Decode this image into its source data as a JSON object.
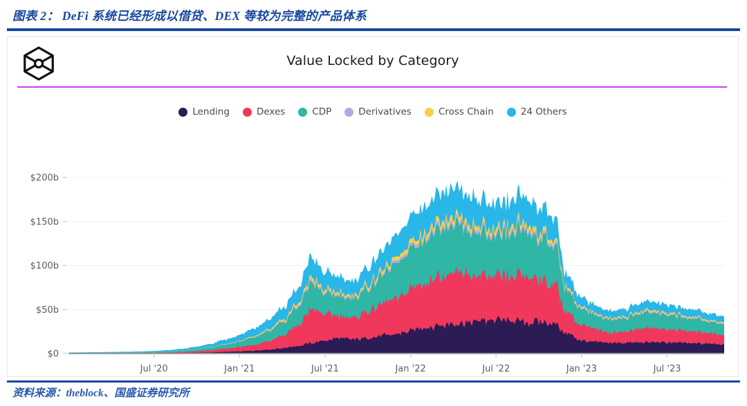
{
  "report": {
    "title": "图表 2： DeFi 系统已经形成以借贷、DEX 等较为完整的产品体系",
    "source": "资料来源：theblock、国盛证券研究所",
    "rule_color": "#14479e",
    "title_color": "#18479e"
  },
  "card": {
    "logo_name": "theblock-hexagon-logo",
    "divider_color": "#cc3df0",
    "border_color": "#e6e6e6"
  },
  "chart_data": {
    "type": "area",
    "stacked": true,
    "title": "Value Locked by Category",
    "xlabel": "",
    "ylabel": "",
    "ylim": [
      0,
      200
    ],
    "y_unit": "b",
    "y_ticks": [
      0,
      50,
      100,
      150,
      200
    ],
    "y_tick_labels": [
      "$0",
      "$50b",
      "$100b",
      "$150b",
      "$200b"
    ],
    "x_ticks": [
      6,
      12,
      18,
      24,
      30,
      36,
      42
    ],
    "x_tick_labels": [
      "Jul '20",
      "Jan '21",
      "Jul '21",
      "Jan '22",
      "Jul '22",
      "Jan '23",
      "Jul '23"
    ],
    "x_range": [
      0,
      46
    ],
    "grid": true,
    "legend_position": "top-center",
    "series": [
      {
        "name": "Lending",
        "color": "#2c1b54",
        "values": [
          0.15,
          0.2,
          0.25,
          0.3,
          0.35,
          0.4,
          0.5,
          0.6,
          0.8,
          1.0,
          1.3,
          1.8,
          2.4,
          3.2,
          4.5,
          6.0,
          8.5,
          11.5,
          15.0,
          17.5,
          16.0,
          18.0,
          20.0,
          22.0,
          26.0,
          29.0,
          32.0,
          34.0,
          35.5,
          37.0,
          38.5,
          37.0,
          35.0,
          36.5,
          34.0,
          22.0,
          14.5,
          13.0,
          12.5,
          12.0,
          12.5,
          13.0,
          12.5,
          12.0,
          11.5,
          11.0,
          10.5
        ]
      },
      {
        "name": "Dexes",
        "color": "#f0385c",
        "values": [
          0.1,
          0.12,
          0.15,
          0.2,
          0.25,
          0.3,
          0.4,
          0.6,
          1.0,
          1.6,
          2.4,
          3.5,
          5.0,
          7.0,
          10.0,
          14.0,
          22.0,
          38.0,
          30.0,
          26.0,
          24.0,
          30.0,
          36.0,
          40.0,
          48.0,
          52.0,
          56.0,
          58.0,
          55.0,
          50.0,
          48.0,
          50.0,
          52.0,
          48.0,
          46.0,
          24.0,
          17.0,
          14.0,
          12.0,
          13.0,
          15.0,
          16.0,
          15.0,
          14.0,
          13.0,
          12.0,
          11.0
        ]
      },
      {
        "name": "CDP",
        "color": "#2fb6a4",
        "values": [
          0.3,
          0.35,
          0.4,
          0.45,
          0.5,
          0.6,
          0.8,
          1.0,
          1.5,
          2.2,
          3.2,
          4.5,
          6.0,
          8.0,
          11.0,
          14.0,
          20.0,
          30.0,
          24.0,
          22.0,
          21.0,
          26.0,
          32.0,
          38.0,
          45.0,
          50.0,
          54.0,
          56.0,
          52.0,
          48.0,
          46.0,
          48.0,
          50.0,
          47.0,
          44.0,
          24.0,
          18.0,
          15.5,
          14.0,
          15.0,
          16.5,
          17.0,
          16.0,
          15.0,
          14.0,
          13.0,
          12.0
        ]
      },
      {
        "name": "Derivatives",
        "color": "#b2a8e5",
        "values": [
          0.02,
          0.02,
          0.03,
          0.03,
          0.04,
          0.05,
          0.06,
          0.08,
          0.1,
          0.15,
          0.2,
          0.3,
          0.4,
          0.6,
          0.9,
          1.2,
          1.8,
          2.5,
          2.0,
          1.8,
          1.7,
          2.0,
          2.4,
          2.8,
          3.2,
          3.5,
          3.8,
          4.0,
          3.8,
          3.5,
          3.4,
          3.6,
          3.8,
          3.5,
          3.3,
          1.8,
          1.3,
          1.1,
          1.0,
          1.1,
          1.2,
          1.3,
          1.2,
          1.1,
          1.0,
          0.9,
          0.9
        ]
      },
      {
        "name": "Cross Chain",
        "color": "#f7d046",
        "values": [
          0.02,
          0.02,
          0.03,
          0.04,
          0.05,
          0.06,
          0.08,
          0.1,
          0.15,
          0.2,
          0.3,
          0.45,
          0.6,
          0.9,
          1.3,
          1.8,
          2.6,
          3.6,
          3.0,
          2.6,
          2.4,
          3.0,
          3.6,
          4.2,
          4.8,
          5.2,
          5.6,
          5.8,
          5.4,
          5.0,
          4.8,
          5.0,
          5.2,
          4.8,
          4.5,
          2.4,
          1.7,
          1.4,
          1.3,
          1.4,
          1.6,
          1.7,
          1.6,
          1.5,
          1.4,
          1.3,
          1.2
        ]
      },
      {
        "name": "24 Others",
        "color": "#29b6e8",
        "values": [
          0.6,
          0.65,
          0.7,
          0.75,
          0.8,
          0.9,
          1.1,
          1.4,
          1.9,
          2.6,
          3.6,
          5.0,
          6.5,
          8.5,
          11.0,
          13.0,
          17.0,
          23.0,
          19.0,
          17.5,
          16.5,
          19.0,
          22.0,
          25.0,
          28.0,
          30.0,
          32.0,
          33.0,
          31.0,
          29.0,
          28.0,
          29.0,
          30.0,
          28.0,
          26.0,
          14.0,
          10.0,
          8.5,
          8.0,
          8.5,
          9.0,
          9.5,
          9.0,
          8.5,
          8.0,
          7.5,
          7.0
        ]
      }
    ]
  }
}
